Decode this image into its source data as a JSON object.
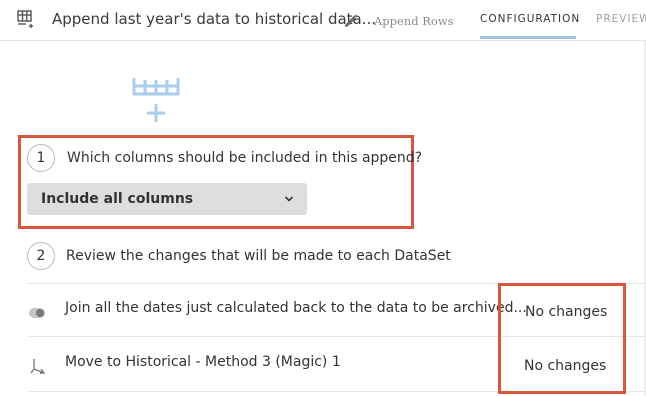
{
  "header": {
    "title": "Append last year's data to historical data...",
    "type_label": "Append Rows",
    "tabs": [
      "CONFIGURATION",
      "PREVIEW"
    ],
    "active_tab": "CONFIGURATION"
  },
  "colors": {
    "highlight_box": "#d9563d",
    "accent_light_blue": "#9bc3e6",
    "dropdown_bg": "#dedede"
  },
  "step1": {
    "number": "1",
    "question": "Which columns should be included in this append?",
    "dropdown_value": "Include all columns"
  },
  "step2": {
    "number": "2",
    "text": "Review the changes that will be made to each DataSet"
  },
  "rows": [
    {
      "icon": "toggle-icon",
      "label": "Join all the dates just calculated back to the data to be archived...",
      "status": "No changes"
    },
    {
      "icon": "merge-arrows-icon",
      "label": "Move to Historical - Method 3 (Magic) 1",
      "status": "No changes"
    }
  ]
}
